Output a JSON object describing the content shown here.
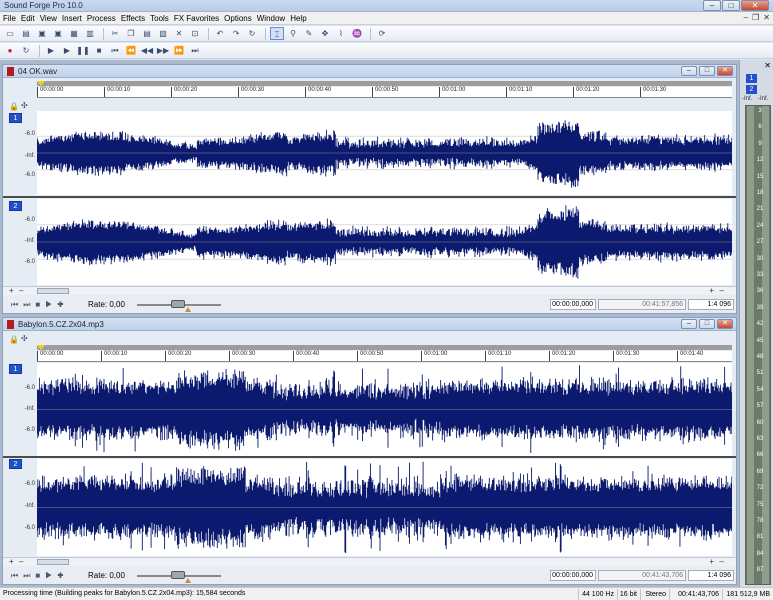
{
  "window": {
    "title": "Sound Forge Pro 10.0",
    "min": "–",
    "max": "□",
    "close": "✕"
  },
  "menu": [
    "File",
    "Edit",
    "View",
    "Insert",
    "Process",
    "Effects",
    "Tools",
    "FX Favorites",
    "Options",
    "Window",
    "Help"
  ],
  "mdi_caps": [
    "–",
    "❐",
    "✕"
  ],
  "toolbar1_icons": [
    "new-icon",
    "open-icon",
    "save-icon",
    "save-as-icon",
    "render-icon",
    "properties-icon",
    "sep",
    "cut-icon",
    "copy-icon",
    "paste-icon",
    "mix-icon",
    "delete-icon",
    "trim-icon",
    "sep",
    "undo-icon",
    "redo-icon",
    "repeat-icon",
    "sep",
    "edit-tool-icon",
    "magnify-tool-icon",
    "pencil-tool-icon",
    "event-tool-icon",
    "envelope-tool-icon",
    "scrub-tool-icon",
    "sep",
    "refresh-icon"
  ],
  "toolbar2_icons": [
    "record-icon",
    "loop-icon",
    "sep",
    "play-all-icon",
    "play-icon",
    "pause-icon",
    "stop-icon",
    "go-start-icon",
    "prev-icon",
    "rewind-icon",
    "forward-icon",
    "next-icon",
    "go-end-icon"
  ],
  "docs": [
    {
      "filename": "04 OK.wav",
      "ruler": [
        "00:00:00",
        "00:00:10",
        "00:00:20",
        "00:00:30",
        "00:00:40",
        "00:00:50",
        "00:01:00",
        "00:01:10",
        "00:01:20",
        "00:01:30"
      ],
      "channels": [
        {
          "label": "1",
          "db": [
            "-6.0",
            "-Inf.",
            "-6.0"
          ]
        },
        {
          "label": "2",
          "db": [
            "-6.0",
            "-Inf.",
            "-6.0"
          ]
        }
      ],
      "rate": "Rate: 0,00",
      "start": "00:00:00,000",
      "end": "00:41:57,856",
      "zoom": "1:4 096"
    },
    {
      "filename": "Babylon.5.CZ.2x04.mp3",
      "ruler": [
        "00:00:00",
        "00:00:10",
        "00:00:20",
        "00:00:30",
        "00:00:40",
        "00:00:50",
        "00:01:00",
        "00:01:10",
        "00:01:20",
        "00:01:30",
        "00:01:40"
      ],
      "channels": [
        {
          "label": "1",
          "db": [
            "-6.0",
            "-Inf.",
            "-6.0"
          ]
        },
        {
          "label": "2",
          "db": [
            "-6.0",
            "-Inf.",
            "-6.0"
          ]
        }
      ],
      "rate": "Rate: 0,00",
      "start": "00:00:00,000",
      "end": "00:41:43,706",
      "zoom": "1:4 096"
    }
  ],
  "meters": {
    "close": "✕",
    "channels": [
      "1",
      "2"
    ],
    "inf_labels": [
      "-Inf.",
      "-Inf."
    ],
    "scale": [
      "3",
      "6",
      "9",
      "12",
      "15",
      "18",
      "21",
      "24",
      "27",
      "30",
      "33",
      "36",
      "39",
      "42",
      "45",
      "48",
      "51",
      "54",
      "57",
      "60",
      "63",
      "66",
      "69",
      "72",
      "75",
      "78",
      "81",
      "84",
      "87"
    ]
  },
  "status": {
    "message": "Processing time (Building peaks for Babylon.5.CZ.2x04.mp3): 15,584 seconds",
    "sample_rate": "44 100 Hz",
    "bit_depth": "16 bit",
    "channels": "Stereo",
    "length": "00:41:43,706",
    "disk": "181 512,9 MB"
  },
  "colors": {
    "waveform": "#0b1a6e",
    "channel_badge": "#2451c9",
    "playhead_marker": "#f1d21f"
  }
}
